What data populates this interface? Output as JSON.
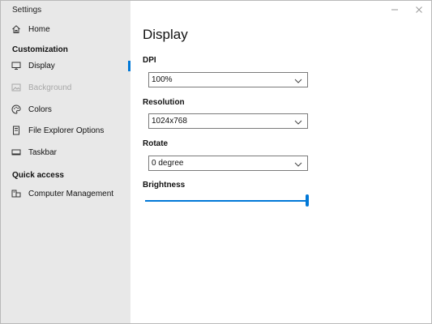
{
  "window": {
    "title": "Settings"
  },
  "sidebar": {
    "home_label": "Home",
    "section_customization": "Customization",
    "items": [
      {
        "label": "Display",
        "icon": "monitor-icon",
        "selected": true,
        "enabled": true
      },
      {
        "label": "Background",
        "icon": "image-icon",
        "selected": false,
        "enabled": false
      },
      {
        "label": "Colors",
        "icon": "palette-icon",
        "selected": false,
        "enabled": true
      },
      {
        "label": "File Explorer Options",
        "icon": "file-explorer-icon",
        "selected": false,
        "enabled": true
      },
      {
        "label": "Taskbar",
        "icon": "taskbar-icon",
        "selected": false,
        "enabled": true
      }
    ],
    "section_quick_access": "Quick access",
    "quick_items": [
      {
        "label": "Computer Management",
        "icon": "computer-management-icon"
      }
    ]
  },
  "content": {
    "title": "Display",
    "dpi": {
      "label": "DPI",
      "value": "100%"
    },
    "resolution": {
      "label": "Resolution",
      "value": "1024x768"
    },
    "rotate": {
      "label": "Rotate",
      "value": "0 degree"
    },
    "brightness": {
      "label": "Brightness",
      "value": 1.0
    }
  },
  "colors": {
    "accent": "#0078d7",
    "sidebar_bg": "#e8e8e8",
    "disabled_text": "#a8a8a8"
  }
}
